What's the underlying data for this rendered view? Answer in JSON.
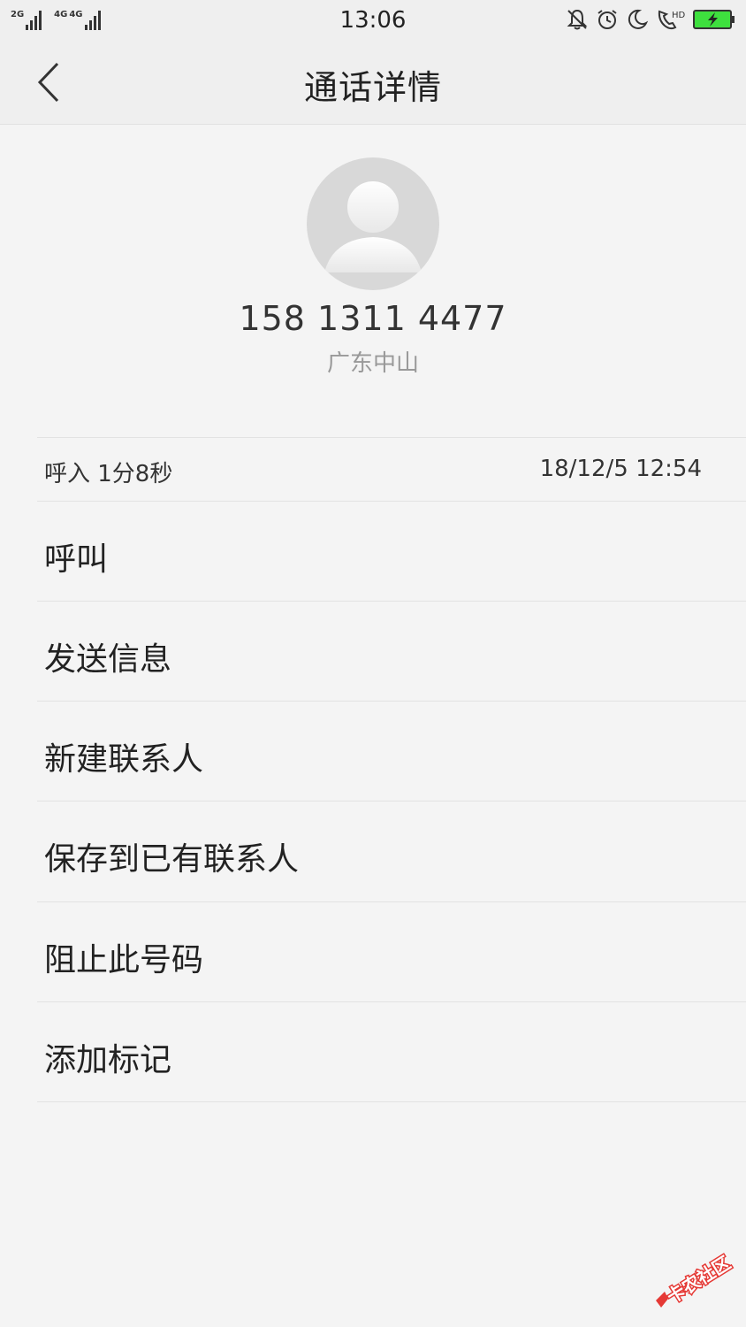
{
  "status_bar": {
    "time": "13:06",
    "network_1": "2G",
    "network_2": "4G",
    "network_3": "4G",
    "icons": [
      "bell-mute-icon",
      "alarm-icon",
      "moon-icon",
      "hd-call-icon",
      "battery-charging-icon"
    ],
    "battery_color": "#3ee03e"
  },
  "header": {
    "title": "通话详情",
    "back_icon": "chevron-left-icon"
  },
  "contact": {
    "avatar_icon": "person-placeholder-icon",
    "phone_number": "158 1311 4477",
    "location": "广东中山"
  },
  "call_record": {
    "type_duration": "呼入  1分8秒",
    "datetime": "18/12/5 12:54"
  },
  "actions": [
    {
      "label": "呼叫"
    },
    {
      "label": "发送信息"
    },
    {
      "label": "新建联系人"
    },
    {
      "label": "保存到已有联系人"
    },
    {
      "label": "阻止此号码"
    },
    {
      "label": "添加标记"
    }
  ],
  "watermark": {
    "logo_text": "卡农社区",
    "color": "#e53935"
  }
}
